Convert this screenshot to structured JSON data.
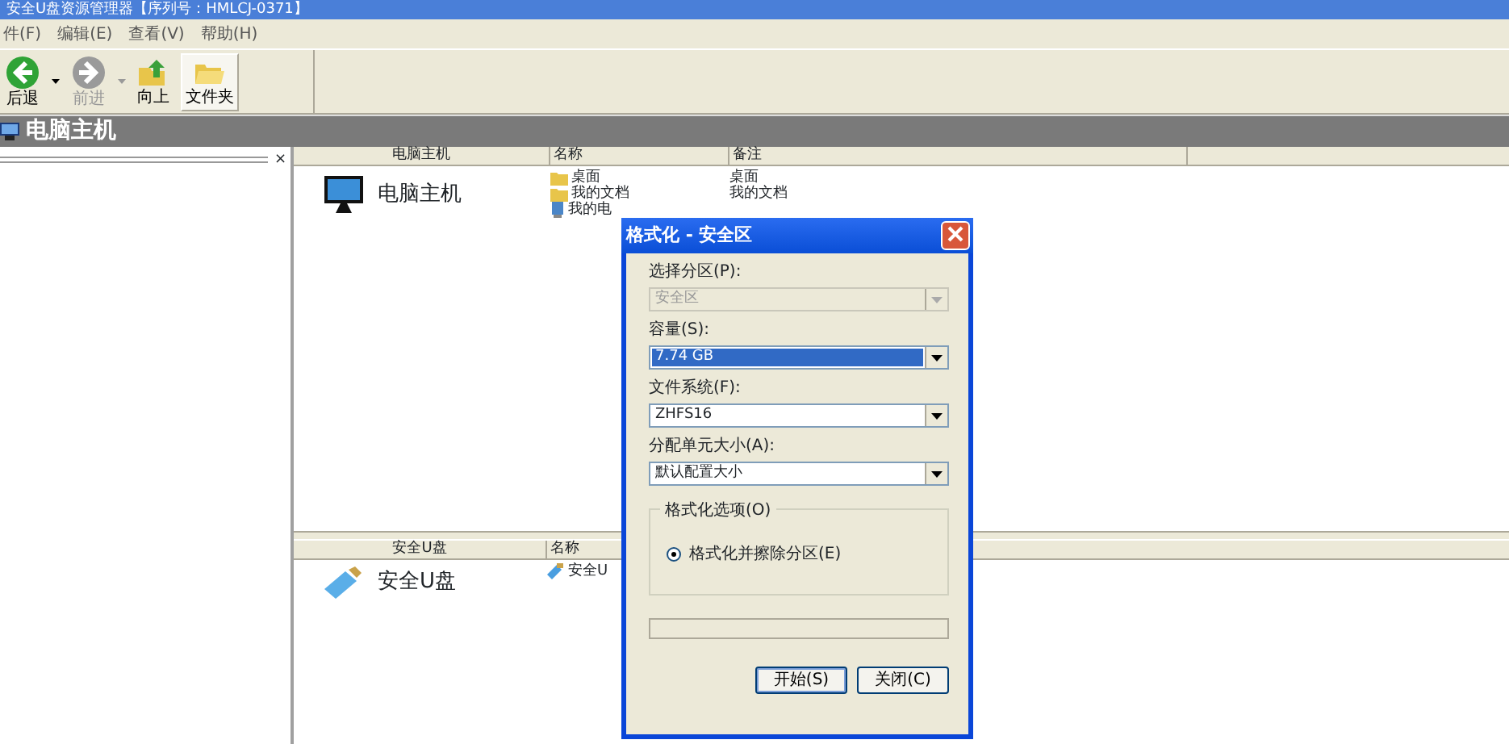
{
  "window": {
    "title": "安全U盘资源管理器【序列号：HMLCJ-0371】"
  },
  "menu": [
    {
      "label": "件(F)"
    },
    {
      "label": "编辑(E)"
    },
    {
      "label": "查看(V)"
    },
    {
      "label": "帮助(H)"
    }
  ],
  "toolbar": [
    {
      "kind": "back",
      "label": "后退",
      "disabled": false,
      "dropdown": true,
      "selected": false
    },
    {
      "kind": "forward",
      "label": "前进",
      "disabled": true,
      "dropdown": true,
      "selected": false
    },
    {
      "kind": "up",
      "label": "向上",
      "disabled": false,
      "dropdown": false,
      "selected": false
    },
    {
      "kind": "folders",
      "label": "文件夹",
      "disabled": false,
      "dropdown": false,
      "selected": true
    }
  ],
  "location": {
    "title": "电脑主机"
  },
  "close_glyph": "×",
  "computer_pane": {
    "columns": [
      "电脑主机",
      "名称",
      "备注"
    ],
    "label": "电脑主机",
    "rows": [
      {
        "kind": "folder",
        "name": "桌面",
        "note": "桌面"
      },
      {
        "kind": "folder",
        "name": "我的文档",
        "note": "我的文档"
      },
      {
        "kind": "computer",
        "name": "我的电",
        "note": ""
      }
    ]
  },
  "usb_pane": {
    "columns": [
      "安全U盘",
      "名称"
    ],
    "label": "安全U盘",
    "rows": [
      {
        "kind": "usb",
        "name": "安全U"
      }
    ]
  },
  "dialog": {
    "title": "格式化 - 安全区",
    "fields": [
      {
        "label": "选择分区(P):",
        "value": "安全区",
        "disabled": true,
        "selected": false
      },
      {
        "label": "容量(S):",
        "value": "7.74 GB",
        "disabled": false,
        "selected": true
      },
      {
        "label": "文件系统(F):",
        "value": "ZHFS16",
        "disabled": false,
        "selected": false
      },
      {
        "label": "分配单元大小(A):",
        "value": "默认配置大小",
        "disabled": false,
        "selected": false
      }
    ],
    "options": {
      "title": "格式化选项(O)",
      "radios": [
        {
          "label": "格式化并擦除分区(E)",
          "checked": true
        }
      ]
    },
    "progress": {
      "level": 0
    },
    "buttons": [
      {
        "label": "开始(S)",
        "default": true
      },
      {
        "label": "关闭(C)",
        "default": false
      }
    ]
  }
}
